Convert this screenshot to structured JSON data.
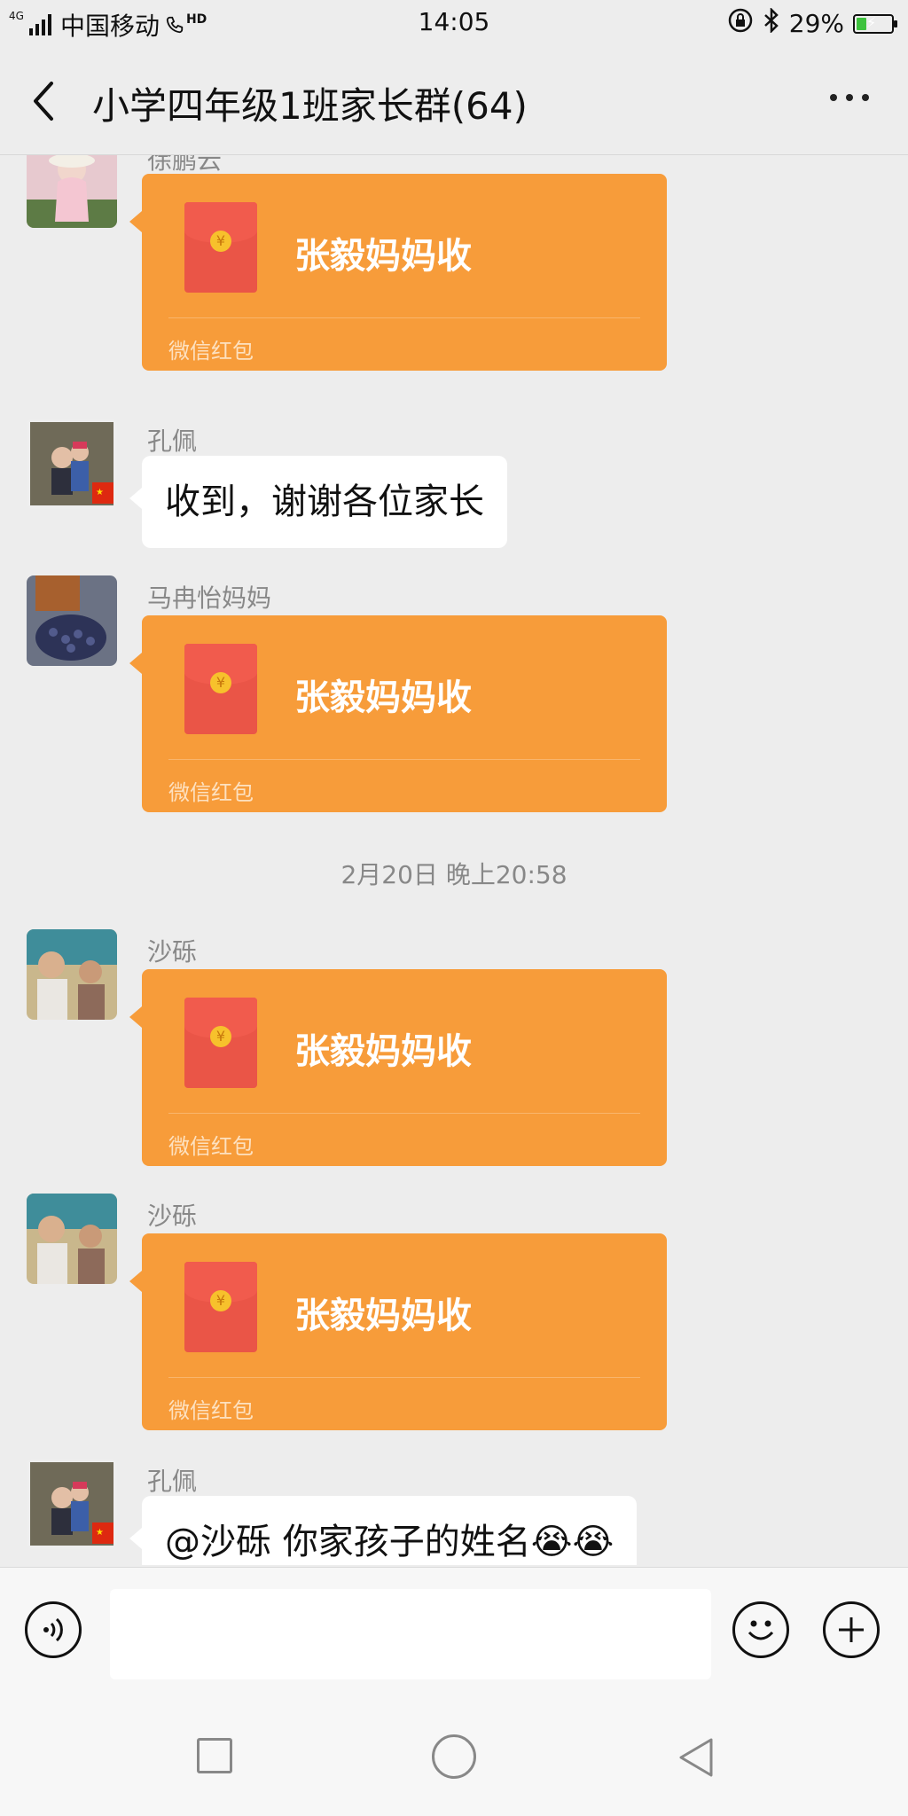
{
  "status_bar": {
    "network_type": "4G",
    "carrier": "中国移动",
    "hd_label": "HD",
    "time": "14:05",
    "battery_percent": "29%",
    "battery_level": 0.29,
    "icons": [
      "signal-icon",
      "hd-call-icon",
      "lock-rotation-icon",
      "bluetooth-icon",
      "battery-icon"
    ]
  },
  "header": {
    "title": "小学四年级1班家长群(64)",
    "back_icon": "chevron-left-icon",
    "more_icon": "more-dots-icon"
  },
  "messages": [
    {
      "type": "red_packet",
      "sender": "徐鹏云",
      "title": "张毅妈妈收",
      "footer": "微信红包"
    },
    {
      "type": "text",
      "sender": "孔佩",
      "text": "收到，谢谢各位家长"
    },
    {
      "type": "red_packet",
      "sender": "马冉怡妈妈",
      "title": "张毅妈妈收",
      "footer": "微信红包"
    },
    {
      "type": "timestamp",
      "text": "2月20日 晚上20:58"
    },
    {
      "type": "red_packet",
      "sender": "沙砾",
      "title": "张毅妈妈收",
      "footer": "微信红包"
    },
    {
      "type": "red_packet",
      "sender": "沙砾",
      "title": "张毅妈妈收",
      "footer": "微信红包"
    },
    {
      "type": "text",
      "sender": "孔佩",
      "text": "@沙砾  你家孩子的姓名😭😭"
    }
  ],
  "input_bar": {
    "text_value": "",
    "voice_icon": "voice-icon",
    "emoji_icon": "emoji-icon",
    "plus_icon": "plus-icon"
  },
  "nav_bar": {
    "icons": [
      "recent-apps-icon",
      "home-icon",
      "back-icon"
    ]
  },
  "colors": {
    "red_packet": "#f79c3a",
    "chat_bg": "#ededed",
    "bubble": "#ffffff",
    "sender_text": "#888888"
  }
}
